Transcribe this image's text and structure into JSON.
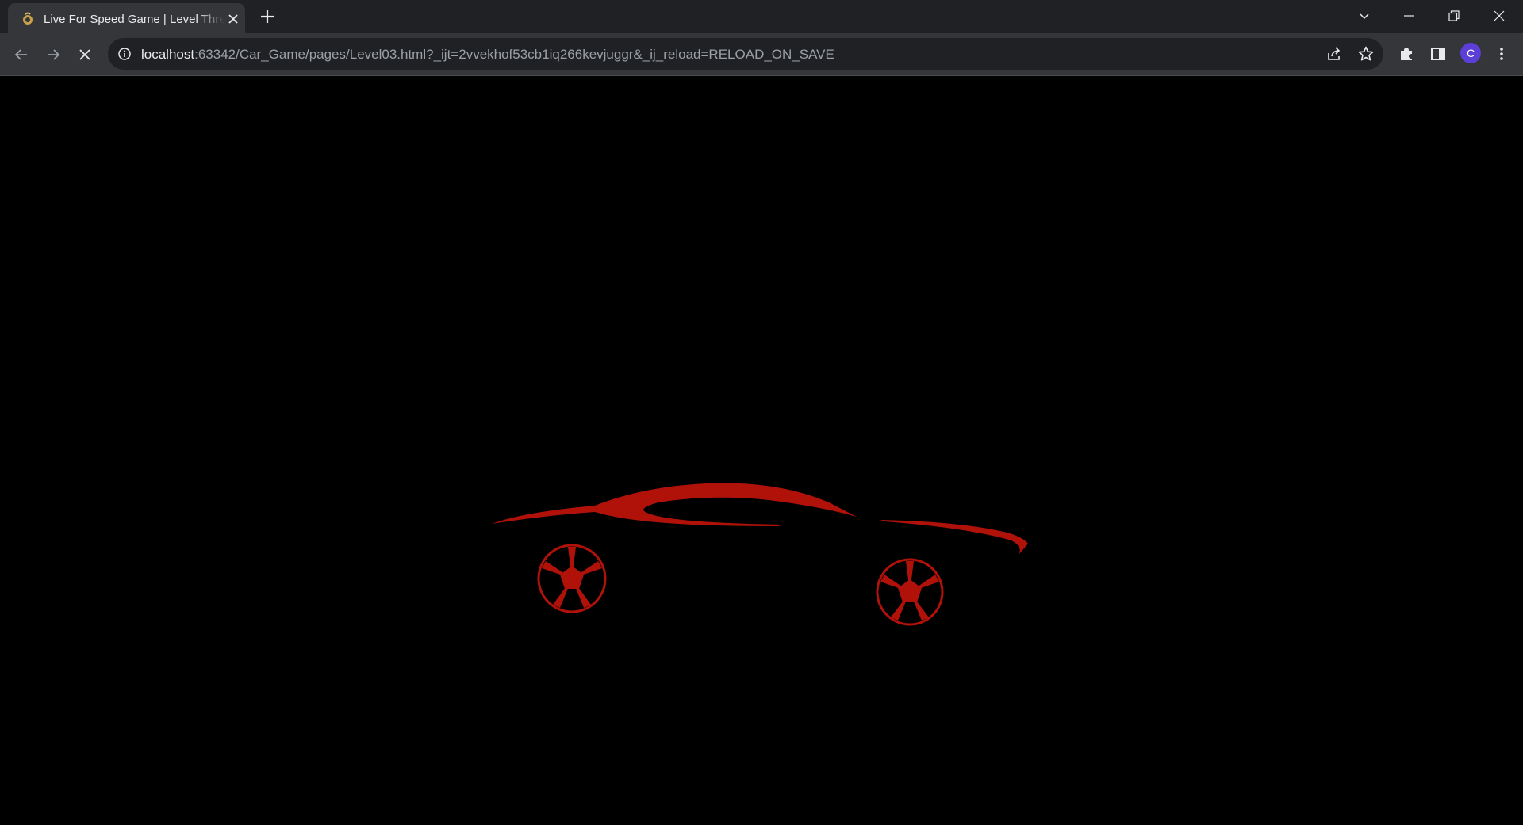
{
  "browser": {
    "tab": {
      "title": "Live For Speed Game | Level Three",
      "favicon": "game-favicon-icon"
    },
    "address_bar": {
      "host": "localhost",
      "rest": ":63342/Car_Game/pages/Level03.html?_ijt=2vvekhof53cb1iq266kevjuggr&_ij_reload=RELOAD_ON_SAVE"
    },
    "profile_initial": "C",
    "loading": true
  },
  "page": {
    "background": "#000000",
    "logo_color": "#b0120a",
    "content": "car-silhouette-logo"
  }
}
